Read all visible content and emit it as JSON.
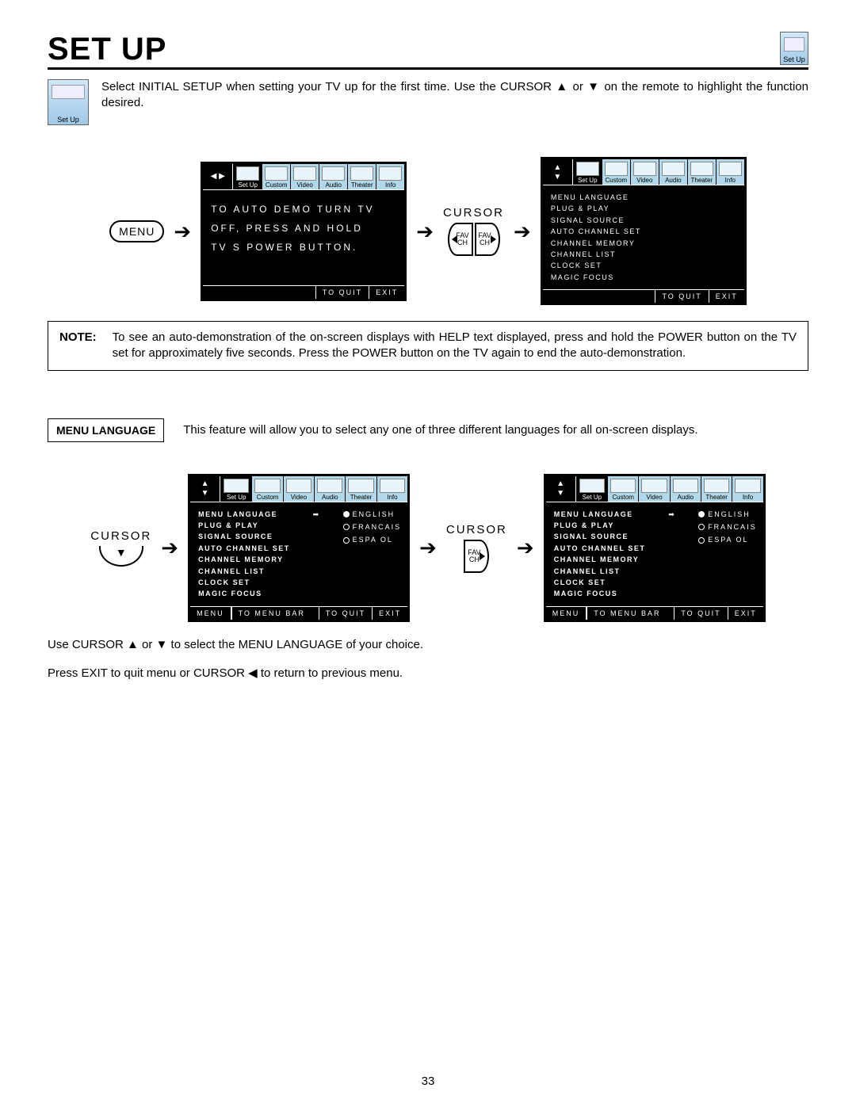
{
  "page_number": "33",
  "title": "SET UP",
  "setup_icon_label": "Set Up",
  "intro_text": "Select INITIAL SETUP when setting your TV up for the first time.  Use the CURSOR ▲ or ▼ on the remote to highlight the function desired.",
  "menu_button": "MENU",
  "cursor_label": "CURSOR",
  "fav_ch": "FAV CH",
  "tabs": [
    "Set Up",
    "Custom",
    "Video",
    "Audio",
    "Theater",
    "Info"
  ],
  "screen1": {
    "line1": "TO AUTO DEMO TURN TV",
    "line2": "OFF, PRESS AND HOLD",
    "line3": "TV S  POWER  BUTTON.",
    "footer_toquit": "TO QUIT",
    "footer_exit": "EXIT"
  },
  "setup_menu_items": [
    "MENU LANGUAGE",
    "PLUG & PLAY",
    "SIGNAL SOURCE",
    "AUTO CHANNEL SET",
    "CHANNEL MEMORY",
    "CHANNEL LIST",
    "CLOCK SET",
    "MAGIC FOCUS"
  ],
  "note_label": "NOTE:",
  "note_text": "To see an auto-demonstration of the on-screen displays with HELP text displayed, press and hold the POWER button on the TV set for approximately five seconds. Press the POWER button on the TV again to end the auto-demonstration.",
  "section_tag": "MENU LANGUAGE",
  "section_desc": "This feature will allow you to select any one of three different languages for all on-screen displays.",
  "lang_options": [
    "ENGLISH",
    "FRANCAIS",
    "ESPA OL"
  ],
  "footer4": {
    "menu": "MENU",
    "bar": "TO MENU BAR",
    "toquit": "TO QUIT",
    "exit": "EXIT"
  },
  "instr1": "Use CURSOR ▲ or ▼ to select the MENU LANGUAGE of your choice.",
  "instr2": "Press EXIT to quit menu or CURSOR ◀ to return to previous menu."
}
